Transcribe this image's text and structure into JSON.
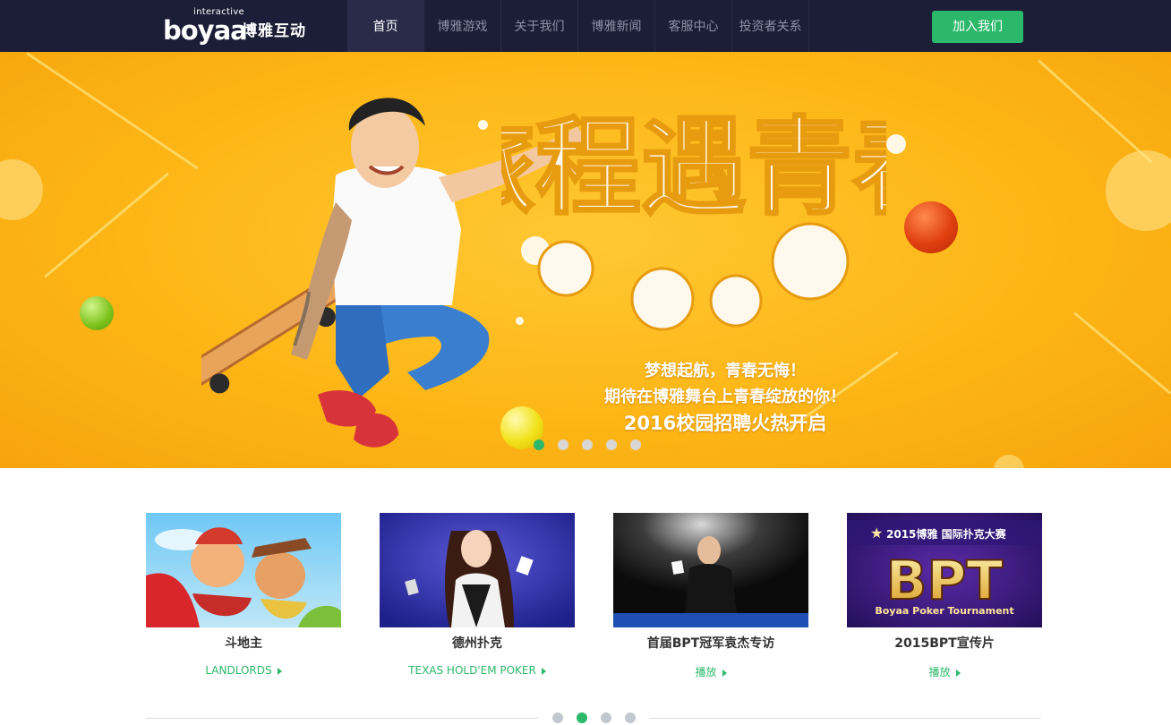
{
  "header": {
    "logo_small": "interactive",
    "logo_brand": "boyaa",
    "logo_cn": "博雅互动",
    "nav": [
      {
        "label": "首页",
        "active": true
      },
      {
        "label": "博雅游戏",
        "active": false
      },
      {
        "label": "关于我们",
        "active": false
      },
      {
        "label": "博雅新闻",
        "active": false
      },
      {
        "label": "客服中心",
        "active": false
      },
      {
        "label": "投资者关系",
        "active": false
      }
    ],
    "join_label": "加入我们"
  },
  "banner": {
    "art_text": "旅程遇青春",
    "line1": "梦想起航，青春无悔！",
    "line2": "期待在博雅舞台上青春绽放的你！",
    "line3": "2016校园招聘火热开启",
    "slides": 5,
    "active_slide": 1
  },
  "games": [
    {
      "title": "斗地主",
      "link": "LANDLORDS",
      "thumb": "landlords-cartoon"
    },
    {
      "title": "德州扑克",
      "link": "TEXAS HOLD'EM POKER",
      "thumb": "poker-dealer-girl"
    },
    {
      "title": "首届BPT冠军袁杰专访",
      "link": "播放",
      "thumb": "bpt-champion-photo"
    },
    {
      "title": "2015BPT宣传片",
      "link": "播放",
      "thumb": "bpt-logo",
      "thumb_header": "2015博雅 国际扑克大赛",
      "thumb_big": "BPT",
      "thumb_sub": "Boyaa Poker Tournament"
    }
  ],
  "games_pager": {
    "pages": 4,
    "active": 2
  },
  "colors": {
    "header_bg": "#1c1d36",
    "accent_green": "#2cb86a",
    "banner_yellow": "#fdb616"
  }
}
